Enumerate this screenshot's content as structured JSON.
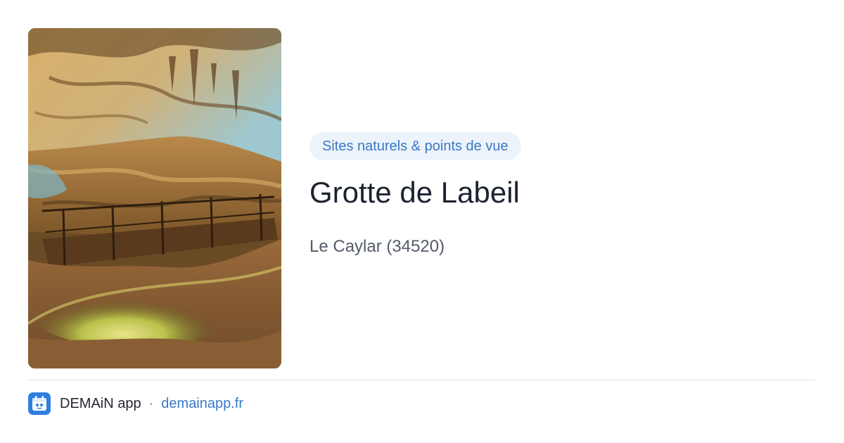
{
  "photo": {
    "subject": "cave-interior-photo",
    "colors": {
      "rock_warm": "#c9a35e",
      "rock_dark": "#4a3118",
      "water_glow": "#c8d24a",
      "ceiling_blue": "#9ec7cf"
    }
  },
  "place": {
    "category": "Sites naturels & points de vue",
    "name": "Grotte de Labeil",
    "location": "Le Caylar (34520)"
  },
  "footer": {
    "app_name": "DEMAiN app",
    "separator": "·",
    "app_link": "demainapp.fr",
    "app_icon": "app-logo-icon"
  },
  "colors": {
    "accent": "#3a78c6",
    "badge_bg": "#edf3fb",
    "title": "#1c2230",
    "muted": "#545b69",
    "divider": "#dde5ec",
    "icon_bg": "#2f7fe0"
  }
}
